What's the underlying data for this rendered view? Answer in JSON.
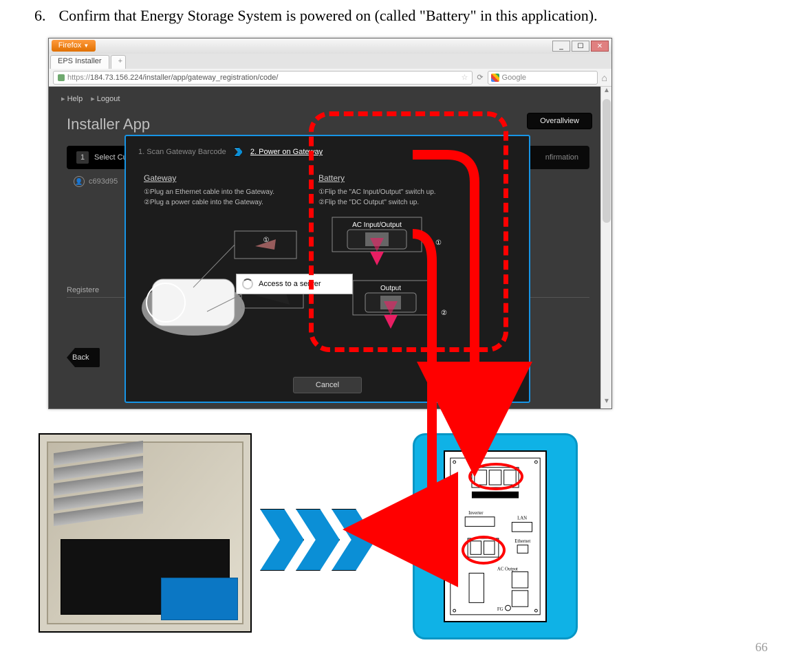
{
  "step": {
    "number": "6.",
    "text": "Confirm that Energy Storage System is powered on (called \"Battery\" in this application)."
  },
  "browser": {
    "firefox_label": "Firefox",
    "tab_title": "EPS Installer",
    "url_display": "184.73.156.224/installer/app/gateway_registration/code/",
    "url_prefix": "https://",
    "search_placeholder": "Google",
    "win_min": "_",
    "win_max": "☐",
    "win_close": "✕"
  },
  "app": {
    "title": "Installer App",
    "help": "Help",
    "logout": "Logout",
    "overall": "Overallview",
    "wizard_step1_num": "1",
    "wizard_step1": "Select Cu",
    "wizard_right": "nfirmation",
    "user_id": "c693d95",
    "registered": "Registere",
    "back": "Back"
  },
  "modal": {
    "crumb1": "1. Scan Gateway Barcode",
    "crumb2": "2. Power on Gateway",
    "gateway_h": "Gateway",
    "gateway_l1": "①Plug an Ethernet cable into the Gateway.",
    "gateway_l2": "②Plug a power cable into the Gateway.",
    "battery_h": "Battery",
    "battery_l1": "①Flip the \"AC Input/Output\" switch up.",
    "battery_l2": "②Flip the \"DC Output\" switch up.",
    "label_ac": "AC Input/Output",
    "label_dc": "Output",
    "num1": "①",
    "num2": "②",
    "cancel": "Cancel",
    "spinner": "Access to a server"
  },
  "ess_labels": {
    "inverter": "Inverter",
    "ethernet": "Ethernet",
    "lan": "LAN",
    "ac_output": "AC Output",
    "fg": "FG"
  },
  "page_number": "66"
}
